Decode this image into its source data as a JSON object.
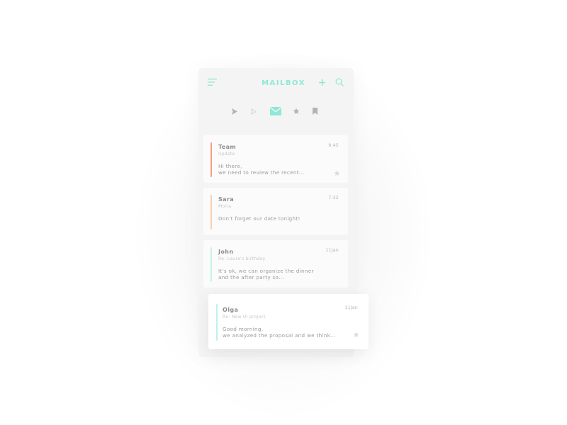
{
  "app": {
    "title": "MAILBOX"
  },
  "colors": {
    "accent": "#8ee8d8",
    "icon_gray": "#b5b5b5",
    "icon_light": "#d2d2d2",
    "bar_orange": "#f4a27e",
    "bar_peach": "#f8cfae",
    "bar_mint": "#c9f1e7",
    "bar_cyan": "#c4eef2"
  },
  "header": {
    "menu_icon": "hamburger-menu-icon",
    "add_icon": "plus-icon",
    "search_icon": "search-icon"
  },
  "tabs": [
    {
      "icon": "send-filled-icon",
      "active": false
    },
    {
      "icon": "send-outline-icon",
      "active": false
    },
    {
      "icon": "envelope-icon",
      "active": true
    },
    {
      "icon": "star-icon",
      "active": false
    },
    {
      "icon": "bookmark-icon",
      "active": false
    }
  ],
  "messages": [
    {
      "sender": "Team",
      "subject": "Update",
      "time": "9:45",
      "preview_line1": "Hi there,",
      "preview_line2": "we need to review the recent...",
      "starred": true,
      "bar_color": "#f4a27e"
    },
    {
      "sender": "Sara",
      "subject": "Moira",
      "time": "7:32",
      "preview_line1": "Don't forget our date tonight!",
      "preview_line2": "",
      "starred": false,
      "bar_color": "#f8cfae"
    },
    {
      "sender": "John",
      "subject": "Re: Laura's birthday",
      "time": "11Jan",
      "preview_line1": "It's ok, we can organize the dinner",
      "preview_line2": "and the after party so...",
      "starred": false,
      "bar_color": "#c9f1e7"
    },
    {
      "sender": "Olga",
      "subject": "Re: New UI project",
      "time": "11Jan",
      "preview_line1": "Good morning,",
      "preview_line2": "we analyzed the proposal and we think...",
      "starred": true,
      "bar_color": "#c4eef2"
    }
  ]
}
